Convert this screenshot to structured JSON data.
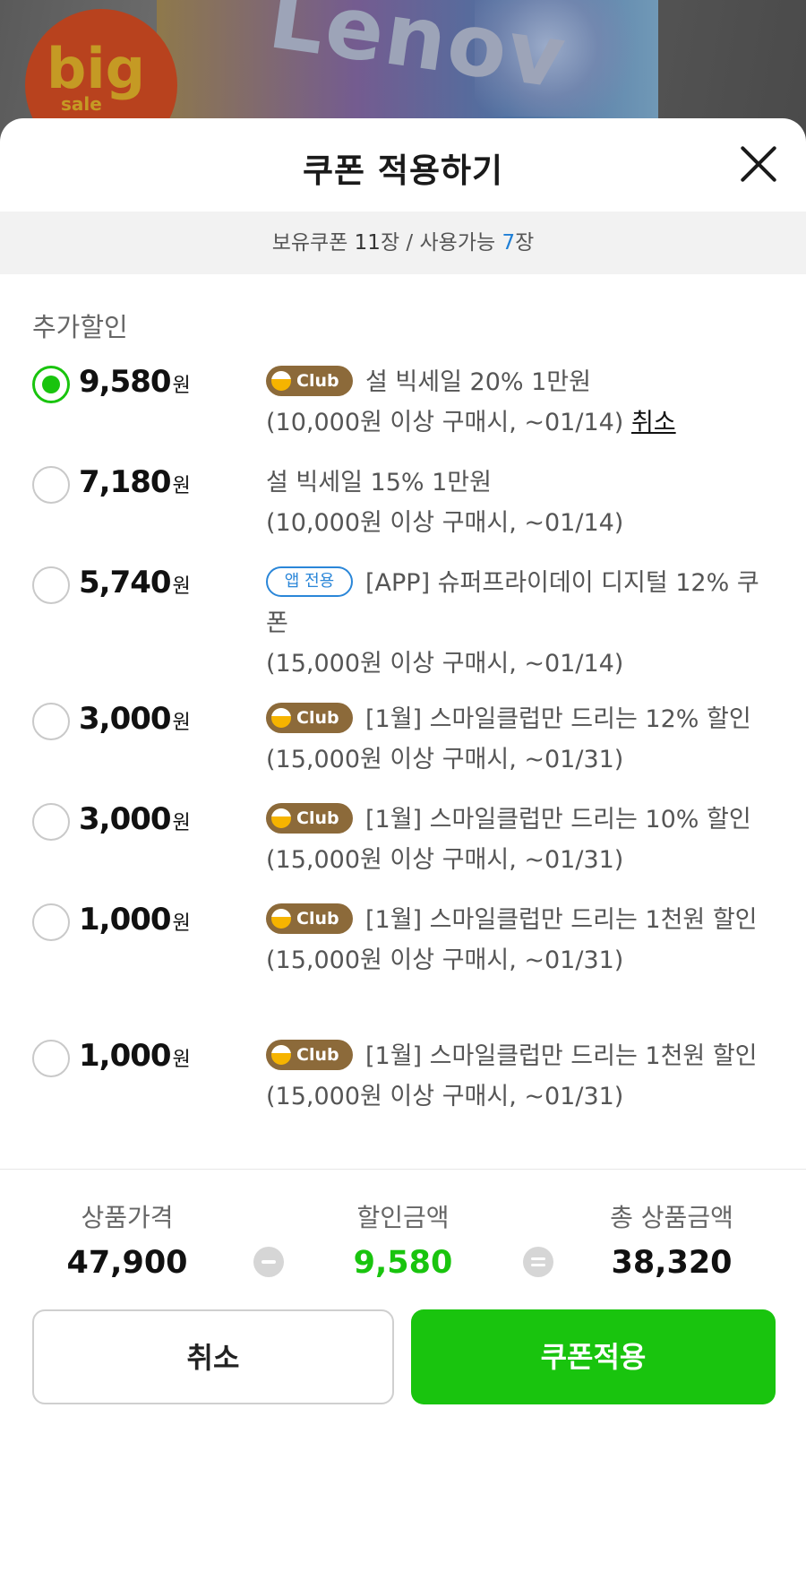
{
  "banner": {
    "logo_big": "big",
    "logo_sale": "sale",
    "brand": "Lenov"
  },
  "sheet": {
    "title": "쿠폰 적용하기"
  },
  "summary": {
    "owned_prefix": "보유쿠폰 ",
    "owned_count": "11",
    "owned_unit": "장",
    "separator": " / ",
    "usable_prefix": "사용가능 ",
    "usable_count": "7",
    "usable_unit": "장"
  },
  "section_label": "추가할인",
  "currency_unit": "원",
  "badges": {
    "club": "Club",
    "app": "앱 전용"
  },
  "coupons": [
    {
      "amount": "9,580",
      "badge": "club",
      "title": "설 빅세일 20% 1만원",
      "condition": "(10,000원 이상 구매시, ~01/14)",
      "cancel": "취소",
      "selected": true
    },
    {
      "amount": "7,180",
      "badge": "",
      "title": "설 빅세일 15% 1만원",
      "condition": "(10,000원 이상 구매시, ~01/14)",
      "selected": false
    },
    {
      "amount": "5,740",
      "badge": "app",
      "title": "[APP] 슈퍼프라이데이 디지털 12% 쿠폰",
      "condition": "(15,000원 이상 구매시, ~01/14)",
      "selected": false
    },
    {
      "amount": "3,000",
      "badge": "club",
      "title": "[1월] 스마일클럽만 드리는 12% 할인",
      "condition": "(15,000원 이상 구매시, ~01/31)",
      "selected": false
    },
    {
      "amount": "3,000",
      "badge": "club",
      "title": "[1월] 스마일클럽만 드리는 10% 할인",
      "condition": "(15,000원 이상 구매시, ~01/31)",
      "selected": false
    },
    {
      "amount": "1,000",
      "badge": "club",
      "title": "[1월] 스마일클럽만 드리는 1천원 할인",
      "condition": "(15,000원 이상 구매시, ~01/31)",
      "selected": false
    },
    {
      "amount": "1,000",
      "badge": "club",
      "title": "[1월] 스마일클럽만 드리는 1천원 할인",
      "condition": "(15,000원 이상 구매시, ~01/31)",
      "selected": false
    }
  ],
  "calc": {
    "price_label": "상품가격",
    "price_value": "47,900",
    "discount_label": "할인금액",
    "discount_value": "9,580",
    "total_label": "총 상품금액",
    "total_value": "38,320"
  },
  "buttons": {
    "cancel": "취소",
    "apply": "쿠폰적용"
  },
  "colors": {
    "accent_green": "#19c40e",
    "club_brown": "#8c6a3a",
    "app_blue": "#2a86d8",
    "count_blue": "#1f7fd6"
  }
}
